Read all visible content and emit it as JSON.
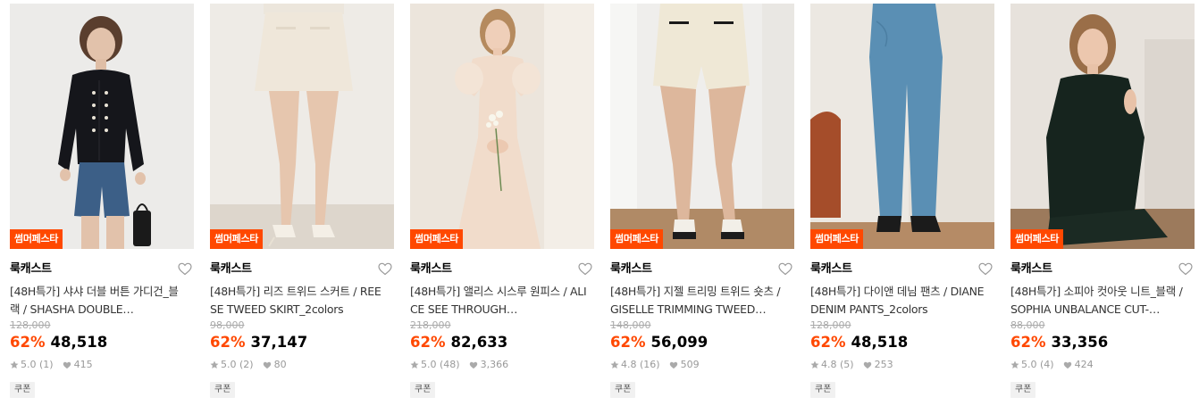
{
  "products": [
    {
      "badge": "썸머페스타",
      "brand": "룩캐스트",
      "name": "[48H특가] 샤샤 더블 버튼 가디건_블랙 / SHASHA DOUBLE…",
      "original_price": "128,000",
      "discount": "62%",
      "price": "48,518",
      "rating": "5.0 (1)",
      "likes": "415",
      "coupon": "쿠폰",
      "image": "model in black cardigan and denim shorts"
    },
    {
      "badge": "썸머페스타",
      "brand": "룩캐스트",
      "name": "[48H특가] 리즈 트위드 스커트 / REESE TWEED SKIRT_2colors",
      "original_price": "98,000",
      "discount": "62%",
      "price": "37,147",
      "rating": "5.0 (2)",
      "likes": "80",
      "coupon": "쿠폰",
      "image": "ivory tweed mini skirt"
    },
    {
      "badge": "썸머페스타",
      "brand": "룩캐스트",
      "name": "[48H특가] 앨리스 시스루 원피스 / ALICE SEE THROUGH…",
      "original_price": "218,000",
      "discount": "62%",
      "price": "82,633",
      "rating": "5.0 (48)",
      "likes": "3,366",
      "coupon": "쿠폰",
      "image": "model in beige see-through dress with flowers"
    },
    {
      "badge": "썸머페스타",
      "brand": "룩캐스트",
      "name": "[48H특가] 지젤 트리밍 트위드 숏츠 / GISELLE TRIMMING TWEED…",
      "original_price": "148,000",
      "discount": "62%",
      "price": "56,099",
      "rating": "4.8 (16)",
      "likes": "509",
      "coupon": "쿠폰",
      "image": "ivory tweed shorts with black trim"
    },
    {
      "badge": "썸머페스타",
      "brand": "룩캐스트",
      "name": "[48H특가] 다이앤 데님 팬츠 / DIANE DENIM PANTS_2colors",
      "original_price": "128,000",
      "discount": "62%",
      "price": "48,518",
      "rating": "4.8 (5)",
      "likes": "253",
      "coupon": "쿠폰",
      "image": "blue straight denim pants"
    },
    {
      "badge": "썸머페스타",
      "brand": "룩캐스트",
      "name": "[48H특가] 소피아 컷아웃 니트_블랙 / SOPHIA UNBALANCE CUT-…",
      "original_price": "88,000",
      "discount": "62%",
      "price": "33,356",
      "rating": "5.0 (4)",
      "likes": "424",
      "coupon": "쿠폰",
      "image": "model in black cut-out knit sitting on floor"
    }
  ],
  "colors": {
    "accent": "#ff4800",
    "text": "#000000",
    "muted": "#999999",
    "strike": "#aaaaaa"
  }
}
